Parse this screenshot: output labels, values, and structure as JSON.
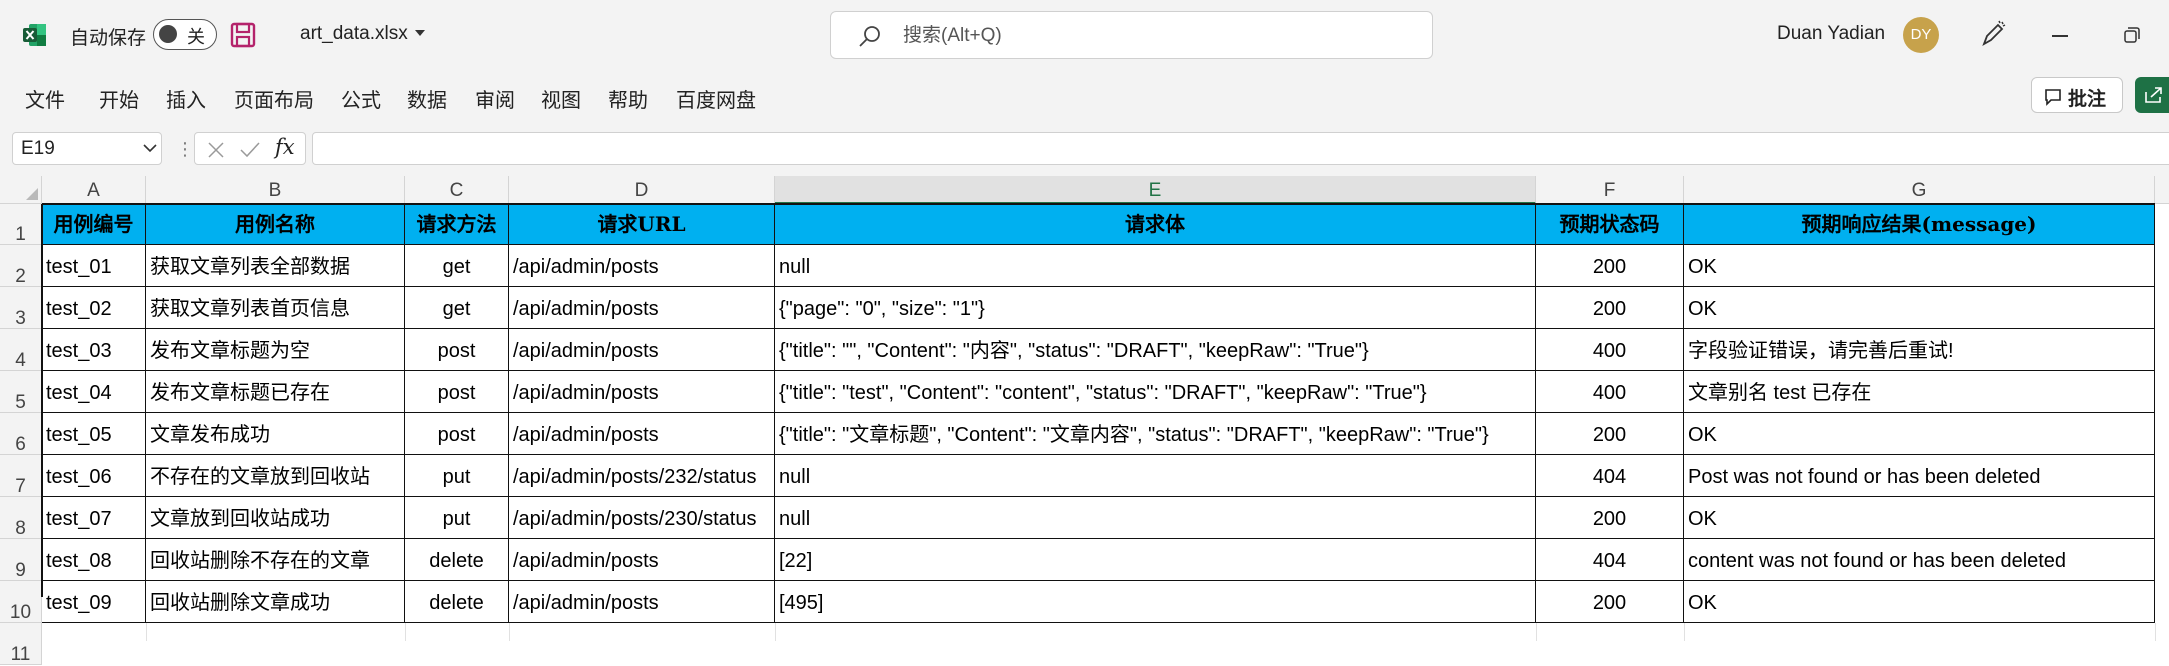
{
  "app": {
    "autosave_label": "自动保存",
    "autosave_state": "关",
    "file_name": "art_data.xlsx",
    "search_placeholder": "搜索(Alt+Q)",
    "user_name": "Duan Yadian",
    "user_initials": "DY",
    "brand_color": "#217346"
  },
  "menu": {
    "items": [
      "文件",
      "开始",
      "插入",
      "页面布局",
      "公式",
      "数据",
      "审阅",
      "视图",
      "帮助",
      "百度网盘"
    ],
    "comment_label": "批注"
  },
  "formula_bar": {
    "cell_ref": "E19",
    "fx": "fx",
    "content": ""
  },
  "sheet": {
    "column_letters": [
      "A",
      "B",
      "C",
      "D",
      "E",
      "F",
      "G"
    ],
    "selected_column": "E",
    "row_numbers": [
      "1",
      "2",
      "3",
      "4",
      "5",
      "6",
      "7",
      "8",
      "9",
      "10",
      "11"
    ],
    "header_fill": "#00b0f0",
    "header": [
      "用例编号",
      "用例名称",
      "请求方法",
      "请求URL",
      "请求体",
      "预期状态码",
      "预期响应结果(message)"
    ],
    "rows": [
      [
        "test_01",
        "获取文章列表全部数据",
        "get",
        "/api/admin/posts",
        "null",
        "200",
        "OK"
      ],
      [
        "test_02",
        "获取文章列表首页信息",
        "get",
        "/api/admin/posts",
        "{\"page\": \"0\", \"size\": \"1\"}",
        "200",
        "OK"
      ],
      [
        "test_03",
        "发布文章标题为空",
        "post",
        "/api/admin/posts",
        "{\"title\": \"\", \"Content\": \"内容\", \"status\": \"DRAFT\", \"keepRaw\": \"True\"}",
        "400",
        "字段验证错误，请完善后重试!"
      ],
      [
        "test_04",
        "发布文章标题已存在",
        "post",
        "/api/admin/posts",
        "{\"title\": \"test\", \"Content\": \"content\", \"status\": \"DRAFT\", \"keepRaw\": \"True\"}",
        "400",
        "文章别名 test 已存在"
      ],
      [
        "test_05",
        "文章发布成功",
        "post",
        "/api/admin/posts",
        "{\"title\": \"文章标题\", \"Content\": \"文章内容\", \"status\": \"DRAFT\", \"keepRaw\": \"True\"}",
        "200",
        "OK"
      ],
      [
        "test_06",
        "不存在的文章放到回收站",
        "put",
        "/api/admin/posts/232/status",
        "null",
        "404",
        "Post was not found or has been deleted"
      ],
      [
        "test_07",
        "文章放到回收站成功",
        "put",
        "/api/admin/posts/230/status",
        "null",
        "200",
        "OK"
      ],
      [
        "test_08",
        "回收站删除不存在的文章",
        "delete",
        "/api/admin/posts",
        "[22]",
        "404",
        "content was not found or has been deleted"
      ],
      [
        "test_09",
        "回收站删除文章成功",
        "delete",
        "/api/admin/posts",
        "[495]",
        "200",
        "OK"
      ]
    ]
  }
}
